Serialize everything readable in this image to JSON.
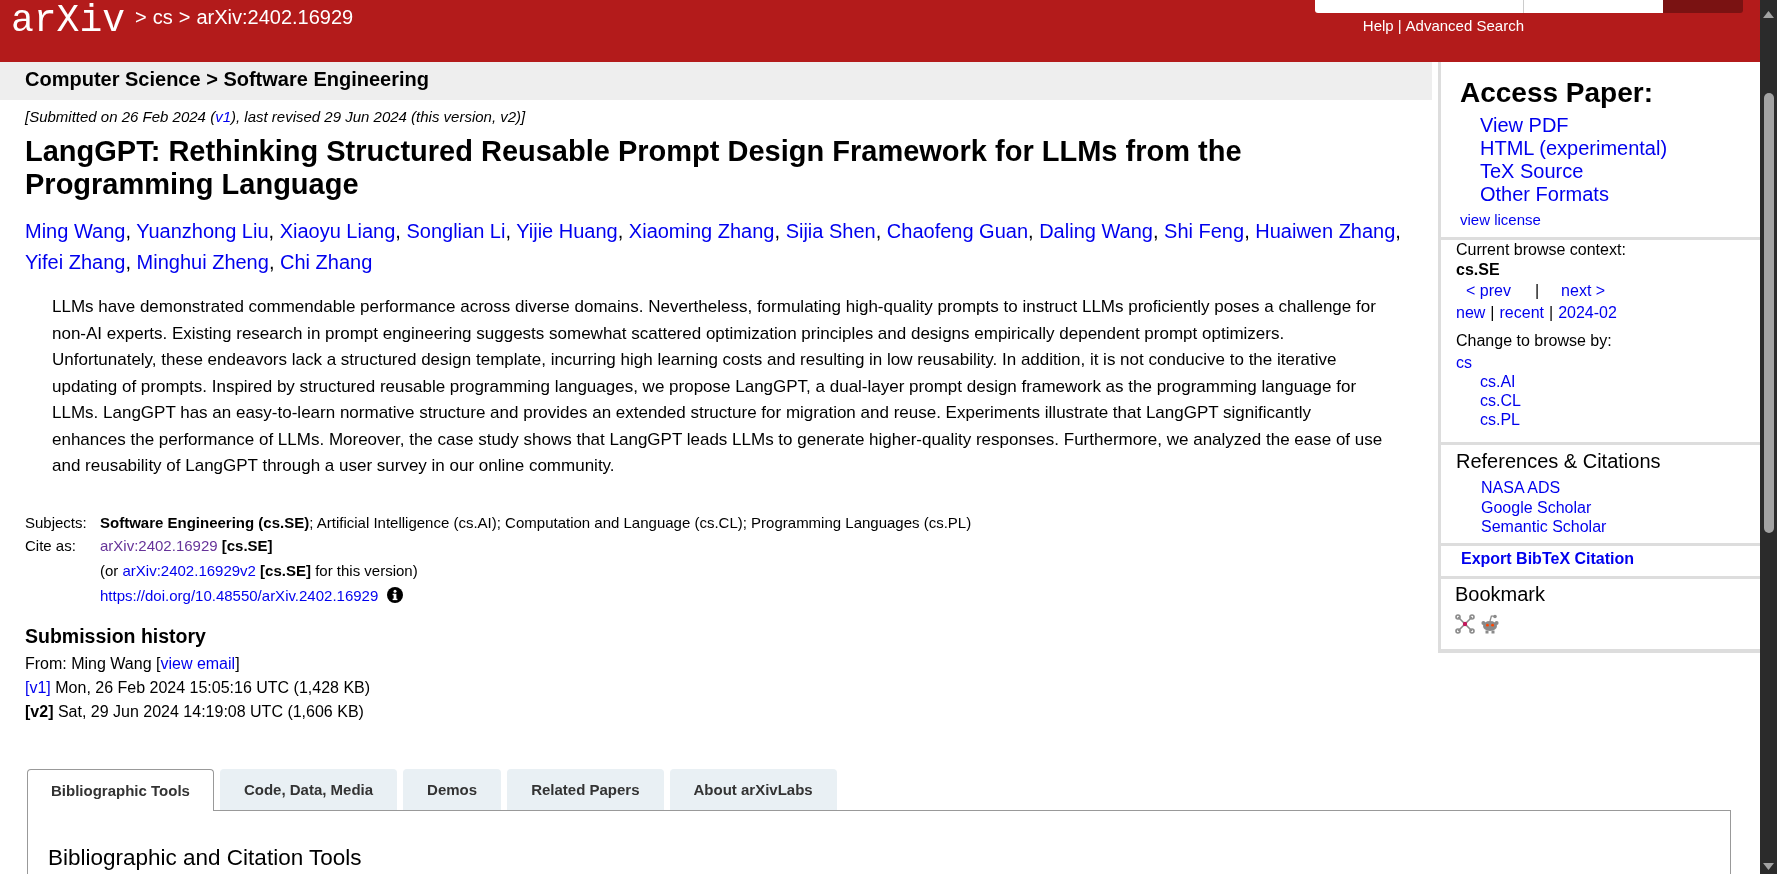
{
  "header": {
    "logo": "arXiv",
    "separator": ">",
    "breadcrumb_links": [
      "cs"
    ],
    "current_id": "arXiv:2402.16929",
    "links": [
      "Help",
      "Advanced Search"
    ],
    "link_separator": "|"
  },
  "category_bar": "Computer Science > Software Engineering",
  "submitted": {
    "before": "[Submitted on 26 Feb 2024 (",
    "link": "v1",
    "after": "), last revised 29 Jun 2024 (this version, v2)]"
  },
  "title": "LangGPT: Rethinking Structured Reusable Prompt Design Framework for LLMs from the Programming Language",
  "authors": {
    "separator": ",",
    "names": [
      "Ming Wang",
      "Yuanzhong Liu",
      "Xiaoyu Liang",
      "Songlian Li",
      "Yijie Huang",
      "Xiaoming Zhang",
      "Sijia Shen",
      "Chaofeng Guan",
      "Daling Wang",
      "Shi Feng",
      "Huaiwen Zhang",
      "Yifei Zhang",
      "Minghui Zheng",
      "Chi Zhang"
    ]
  },
  "abstract": "LLMs have demonstrated commendable performance across diverse domains. Nevertheless, formulating high-quality prompts to instruct LLMs proficiently poses a challenge for non-AI experts. Existing research in prompt engineering suggests somewhat scattered optimization principles and designs empirically dependent prompt optimizers. Unfortunately, these endeavors lack a structured design template, incurring high learning costs and resulting in low reusability. In addition, it is not conducive to the iterative updating of prompts. Inspired by structured reusable programming languages, we propose LangGPT, a dual-layer prompt design framework as the programming language for LLMs. LangGPT has an easy-to-learn normative structure and provides an extended structure for migration and reuse. Experiments illustrate that LangGPT significantly enhances the performance of LLMs. Moreover, the case study shows that LangGPT leads LLMs to generate higher-quality responses. Furthermore, we analyzed the ease of use and reusability of LangGPT through a user survey in our online community.",
  "metadata": {
    "subjects": {
      "label": "Subjects:",
      "value": "**Software Engineering (cs.SE)**; Artificial Intelligence (cs.AI); Computation and Language (cs.CL); Programming Languages (cs.PL)"
    },
    "cite": {
      "label": "Cite as:",
      "lines": [
        {
          "link": "arXiv:2402.16929",
          "after": " **[cs.SE]**",
          "visited": true,
          "info": false
        },
        {
          "before": "(or ",
          "link": "arXiv:2402.16929v2",
          "after": " **[cs.SE]** for this version)",
          "visited": false,
          "info": false
        },
        {
          "link": "https://doi.org/10.48550/arXiv.2402.16929",
          "visited": false,
          "info": true
        }
      ]
    }
  },
  "history": {
    "title": "Submission history",
    "from": {
      "before": "From: Ming Wang [",
      "link": "view email",
      "after": "]"
    },
    "versions": [
      {
        "label": "[v1]",
        "current": false,
        "details": "Mon, 26 Feb 2024 15:05:16 UTC (1,428 KB)"
      },
      {
        "label": "[v2]",
        "current": true,
        "details": "Sat, 29 Jun 2024 14:19:08 UTC (1,606 KB)"
      }
    ]
  },
  "tabs": [
    {
      "label": "Bibliographic Tools",
      "selected": true
    },
    {
      "label": "Code, Data, Media",
      "selected": false
    },
    {
      "label": "Demos",
      "selected": false
    },
    {
      "label": "Related Papers",
      "selected": false
    },
    {
      "label": "About arXivLabs",
      "selected": false
    }
  ],
  "tab_panel": {
    "title": "Bibliographic and Citation Tools"
  },
  "sidebar": {
    "access": {
      "title": "Access Paper:",
      "links": [
        "View PDF",
        "HTML (experimental)",
        "TeX Source",
        "Other Formats"
      ],
      "license": "view license"
    },
    "browse": {
      "title": "Current browse context:",
      "context": "cs.SE",
      "prev": "< prev",
      "next": "next >",
      "separator": "|",
      "lists": [
        "new",
        "recent",
        "2024-02"
      ],
      "change_title": "Change to browse by:",
      "categories": [
        {
          "label": "cs",
          "children": [
            {
              "label": "cs.AI"
            },
            {
              "label": "cs.CL"
            },
            {
              "label": "cs.PL"
            }
          ]
        }
      ]
    },
    "references": {
      "title": "References & Citations",
      "links": [
        "NASA ADS",
        "Google Scholar",
        "Semantic Scholar"
      ]
    },
    "export": "Export BibTeX Citation",
    "bookmark": {
      "title": "Bookmark"
    }
  }
}
